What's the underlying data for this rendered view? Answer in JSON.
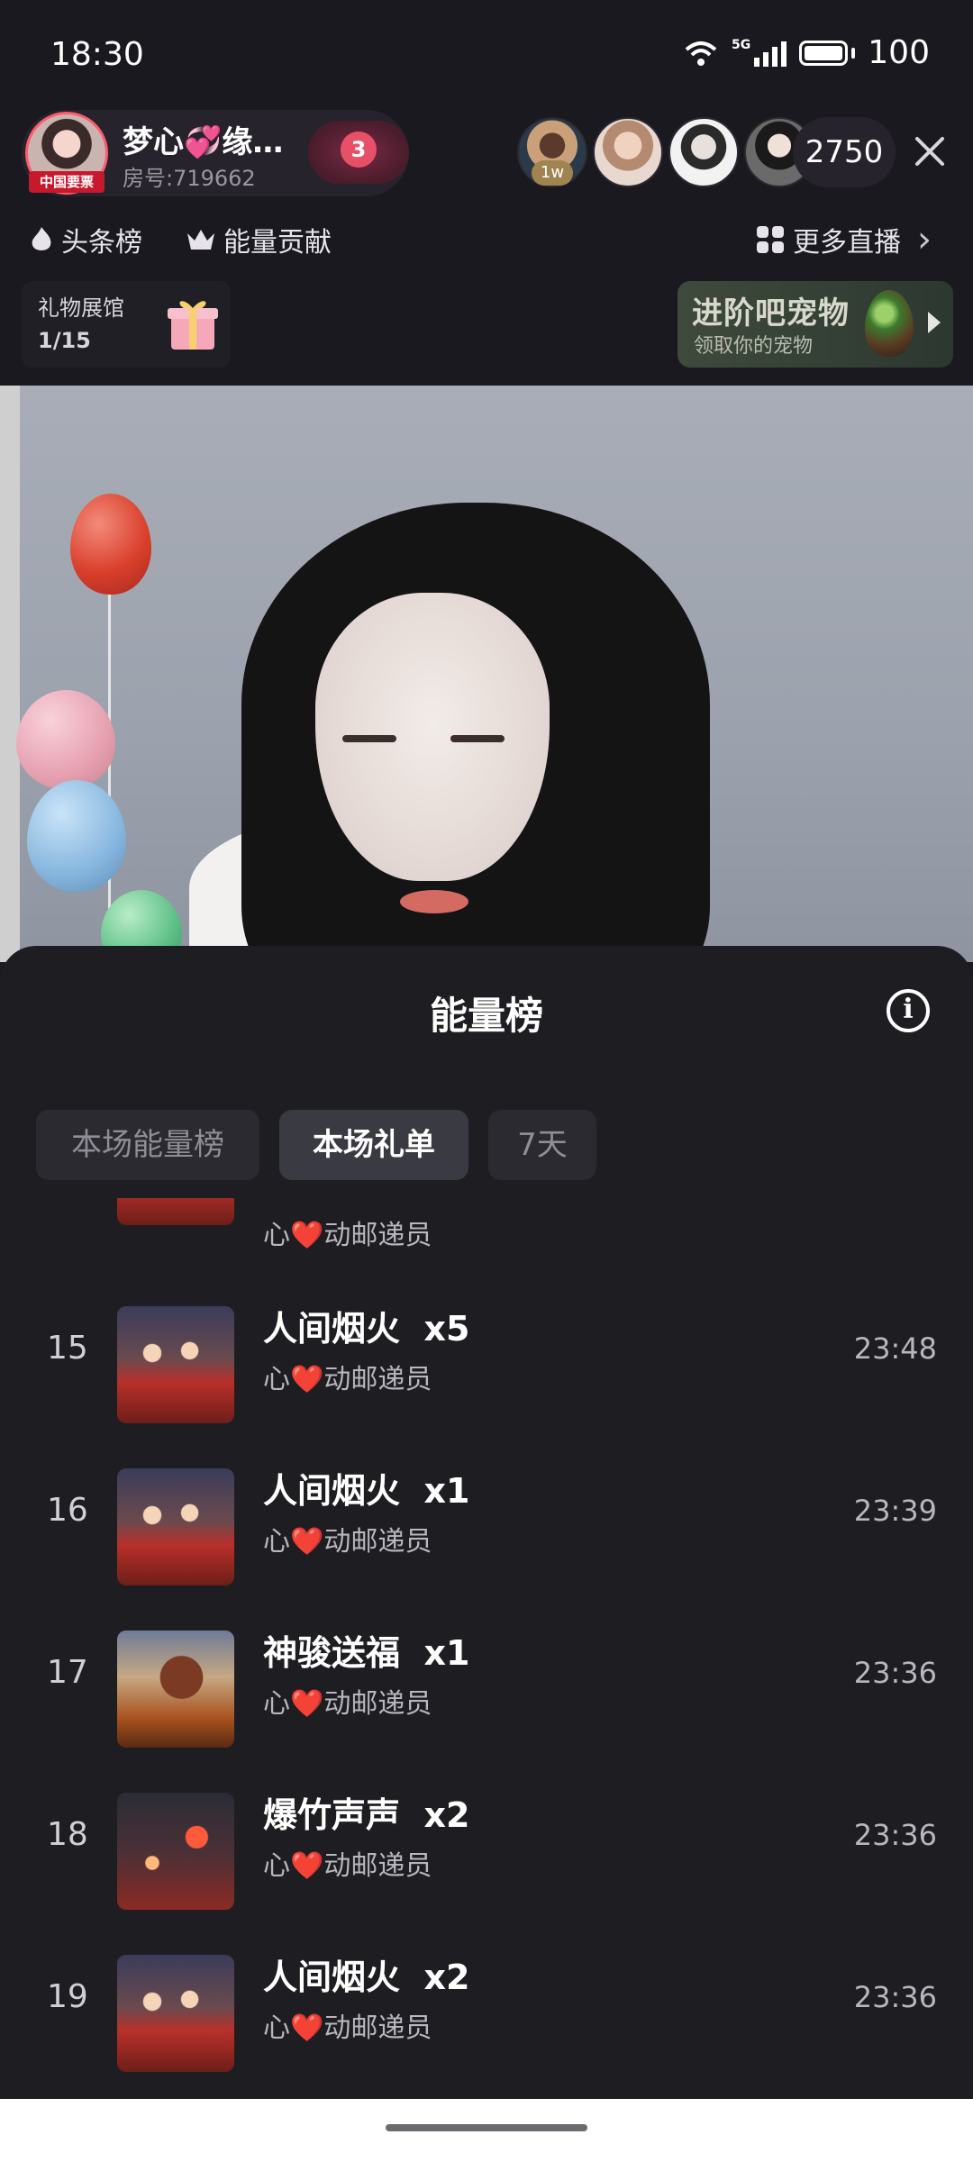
{
  "status_bar": {
    "time": "18:30",
    "network": "5G",
    "battery": "100"
  },
  "host": {
    "name": "梦心💞缘…",
    "room": "房号:719662",
    "avatar_tag": "中国要票",
    "level": "3"
  },
  "viewers": {
    "top_badge": "1w",
    "count": "2750"
  },
  "chips": {
    "headline": "头条榜",
    "energy": "能量贡献",
    "more_live": "更多直播"
  },
  "gift_hall": {
    "title": "礼物展馆",
    "count": "1/15"
  },
  "pet_banner": {
    "title": "进阶吧宠物",
    "subtitle": "领取你的宠物"
  },
  "sheet": {
    "title": "能量榜",
    "tabs": [
      "本场能量榜",
      "本场礼单",
      "7天"
    ],
    "active_tab": "本场礼单",
    "partial_row_sender": "心❤️动邮递员",
    "rows": [
      {
        "rank": "15",
        "gift": "人间烟火  x5",
        "sender_prefix": "心",
        "sender_suffix": "动邮递员",
        "time": "23:48",
        "thumb": "yanhuo"
      },
      {
        "rank": "16",
        "gift": "人间烟火  x1",
        "sender_prefix": "心",
        "sender_suffix": "动邮递员",
        "time": "23:39",
        "thumb": "yanhuo"
      },
      {
        "rank": "17",
        "gift": "神骏送福  x1",
        "sender_prefix": "心",
        "sender_suffix": "动邮递员",
        "time": "23:36",
        "thumb": "horse"
      },
      {
        "rank": "18",
        "gift": "爆竹声声  x2",
        "sender_prefix": "心",
        "sender_suffix": "动邮递员",
        "time": "23:36",
        "thumb": "firecracker"
      },
      {
        "rank": "19",
        "gift": "人间烟火  x2",
        "sender_prefix": "心",
        "sender_suffix": "动邮递员",
        "time": "23:36",
        "thumb": "yanhuo"
      }
    ]
  },
  "icons": {
    "close": "close-icon",
    "info": "info-icon",
    "heart": "❤️",
    "chevron": "›"
  }
}
